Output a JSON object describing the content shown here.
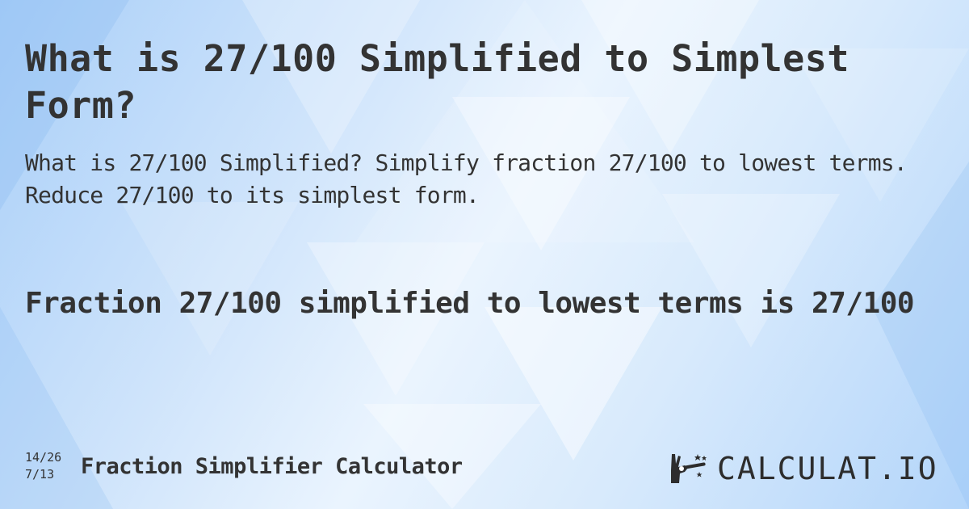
{
  "title": "What is 27/100 Simplified to Simplest Form?",
  "description": "What is 27/100 Simplified? Simplify fraction 27/100 to lowest terms. Reduce 27/100 to its simplest form.",
  "answer": "Fraction 27/100 simplified to lowest terms is 27/100",
  "footer": {
    "icon_fraction_top": "14/26",
    "icon_fraction_bottom": "7/13",
    "calculator_name": "Fraction Simplifier Calculator"
  },
  "logo": {
    "icon": "magic-hand-wand-icon",
    "text": "CALCULAT.IO"
  },
  "colors": {
    "text": "#333333",
    "background_light": "#eaf4fe",
    "background_dark": "#a9cff8"
  }
}
